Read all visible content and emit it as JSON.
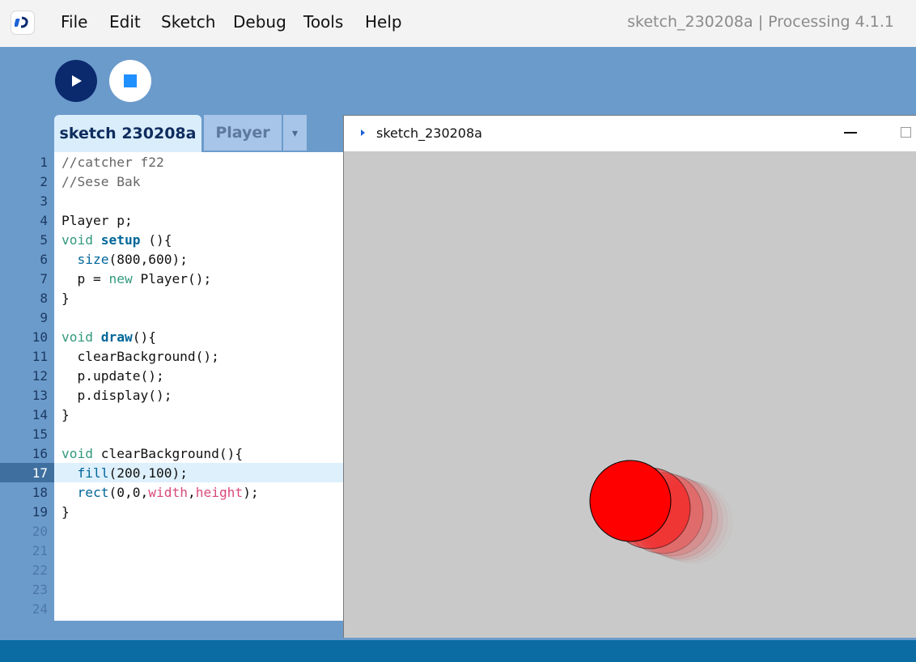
{
  "menubar": {
    "items": [
      {
        "label": "File"
      },
      {
        "label": "Edit"
      },
      {
        "label": "Sketch"
      },
      {
        "label": "Debug"
      },
      {
        "label": "Tools"
      },
      {
        "label": "Help"
      }
    ],
    "window_title": "sketch_230208a | Processing 4.1.1"
  },
  "toolbar": {
    "run_icon": "play-icon",
    "stop_icon": "stop-icon"
  },
  "tabs": [
    {
      "label": "sketch 230208a",
      "active": true
    },
    {
      "label": "Player",
      "active": false
    }
  ],
  "tab_menu_glyph": "▾",
  "editor": {
    "line_numbers": [
      "1",
      "2",
      "3",
      "4",
      "5",
      "6",
      "7",
      "8",
      "9",
      "10",
      "11",
      "12",
      "13",
      "14",
      "15",
      "16",
      "17",
      "18",
      "19",
      "20",
      "21",
      "22",
      "23",
      "24"
    ],
    "highlighted_line": 17
  },
  "sketch_window": {
    "title": "sketch_230208a",
    "icon": "processing-sketch-icon",
    "ball_color": "#ff0000",
    "canvas_color": "#c9c9c9"
  },
  "colors": {
    "accent": "#0b2a6e",
    "editor_bg": "#6b9bcb",
    "status_bar": "#0a6ca3",
    "active_tab": "#d9edfb"
  }
}
